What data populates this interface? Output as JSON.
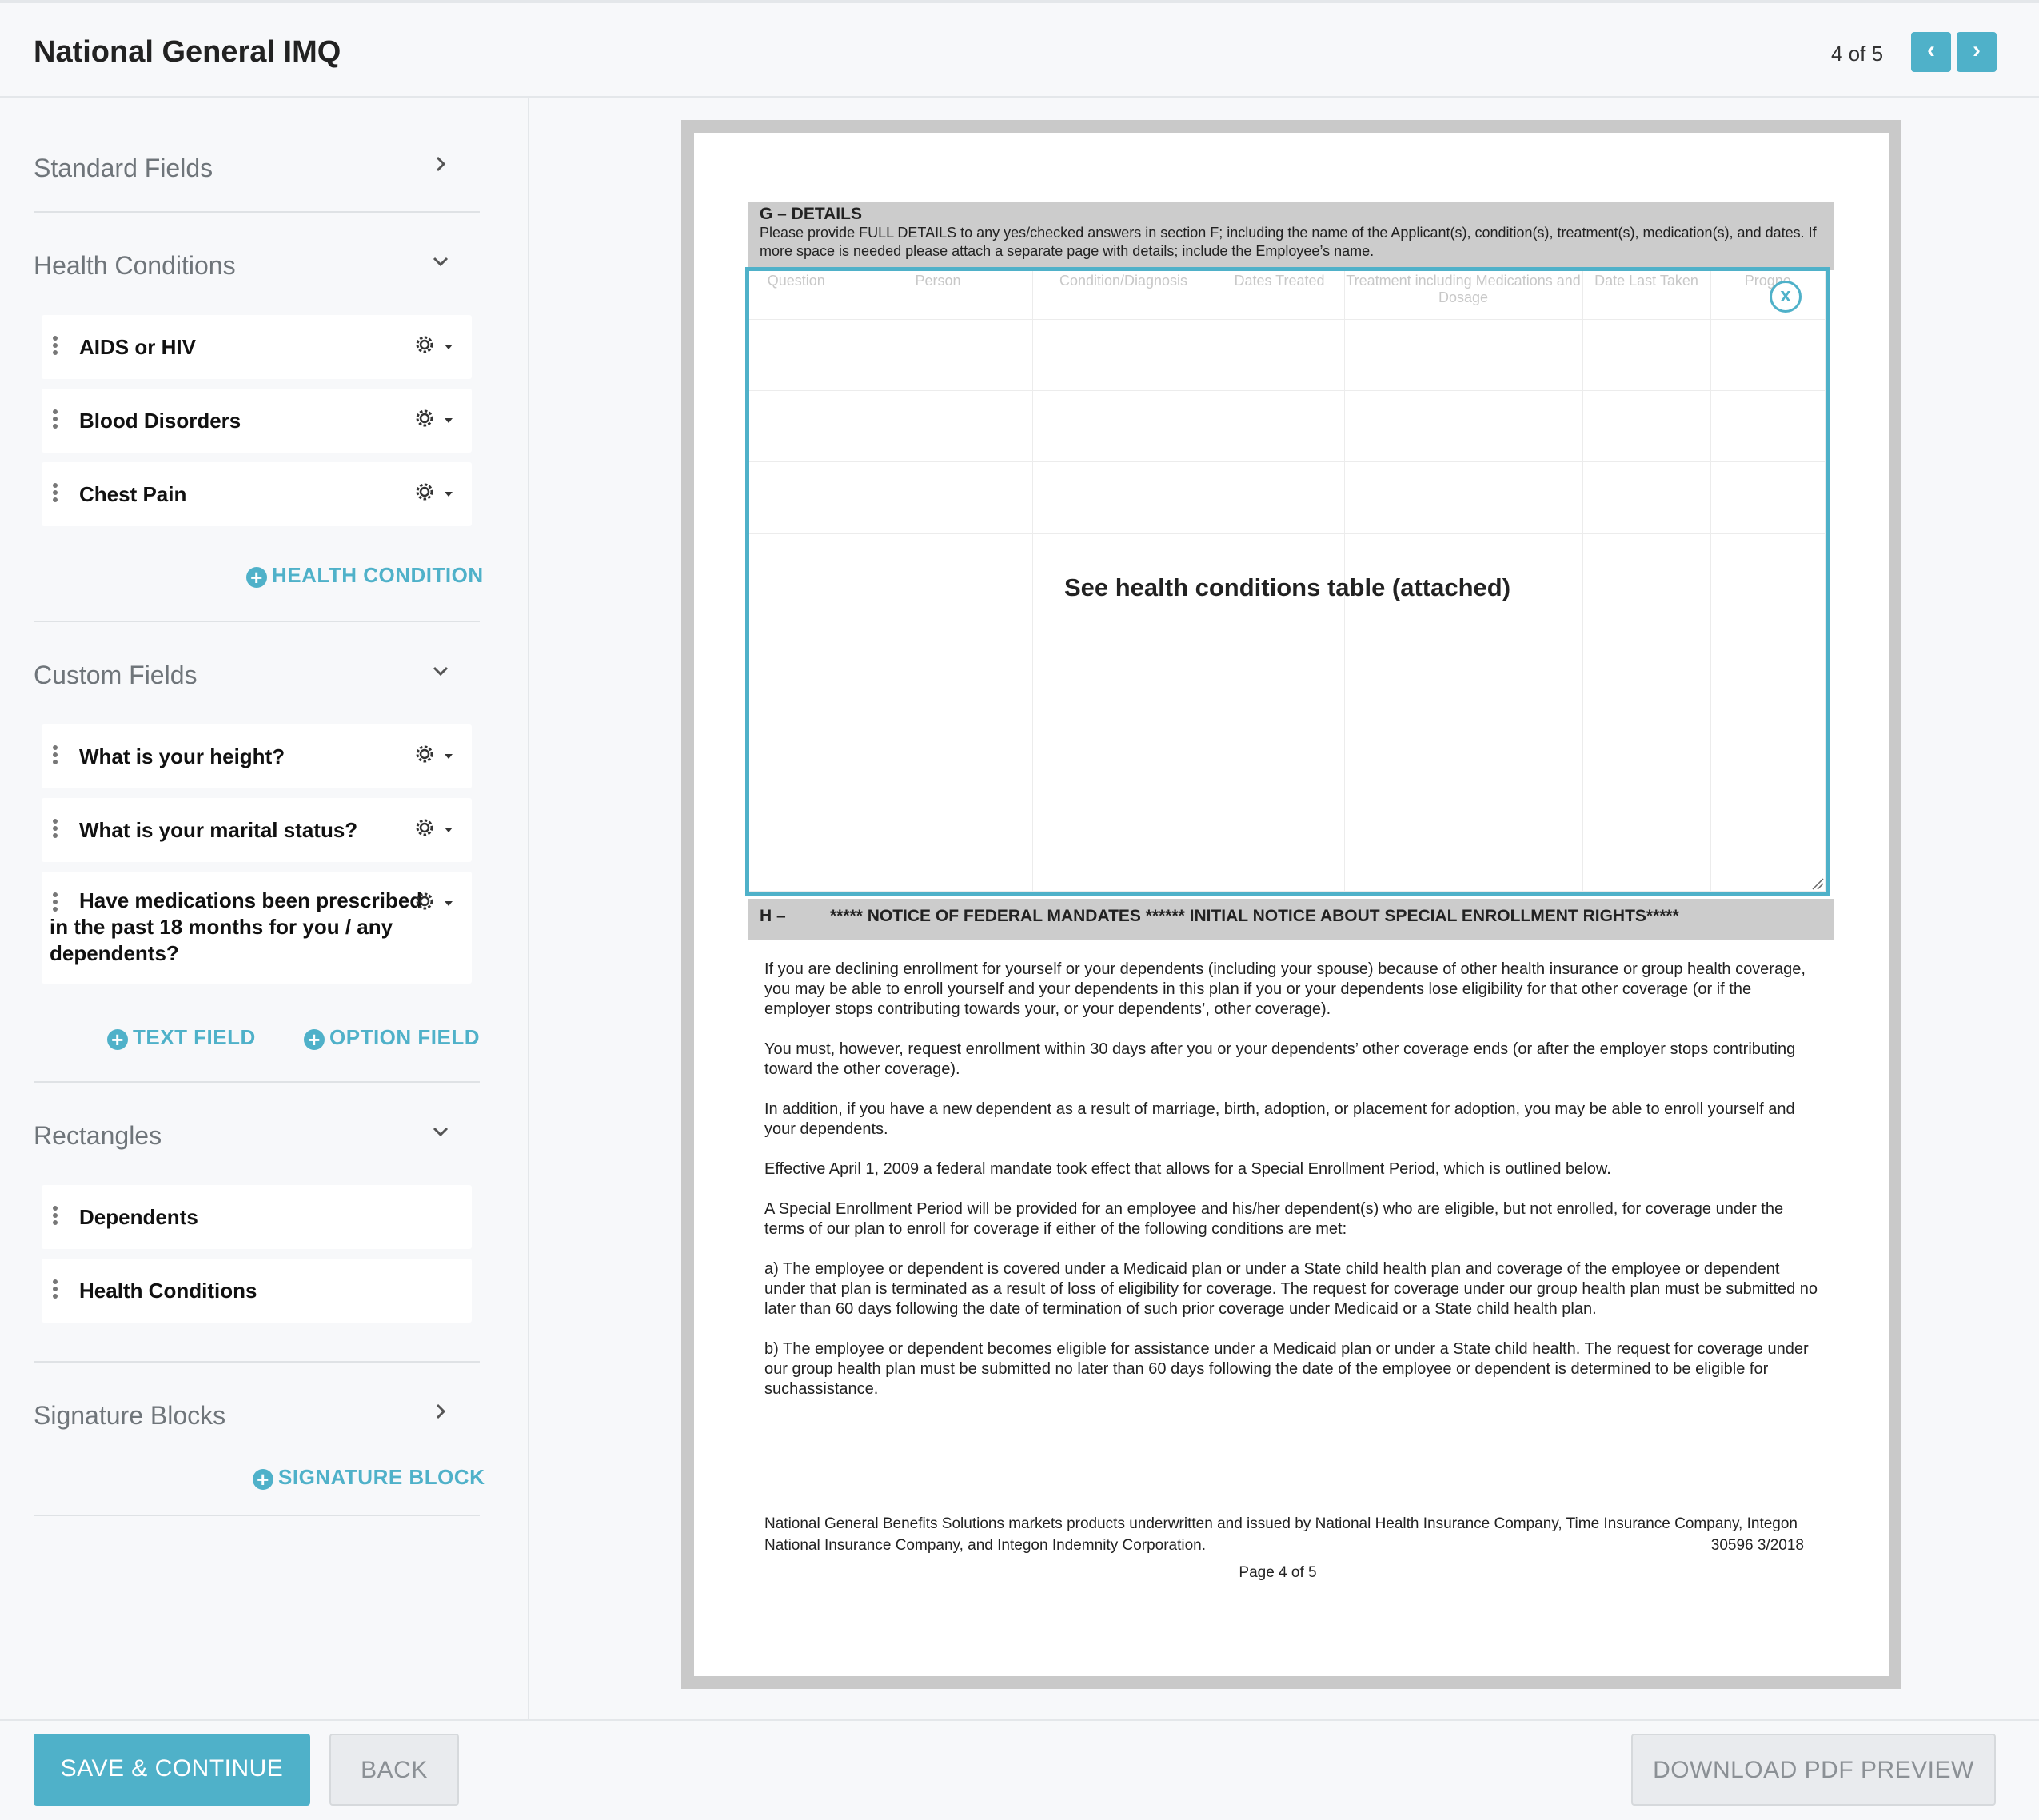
{
  "header": {
    "title": "National General IMQ",
    "pager_text": "4 of 5",
    "prev_symbol": "‹",
    "next_symbol": "›"
  },
  "sidebar": {
    "standard_fields": {
      "title": "Standard Fields"
    },
    "health_conditions": {
      "title": "Health Conditions",
      "items": [
        "AIDS or HIV",
        "Blood Disorders",
        "Chest Pain"
      ],
      "add_label": "HEALTH CONDITION"
    },
    "custom_fields": {
      "title": "Custom Fields",
      "items": [
        "What is your height?",
        "What is your marital status?",
        "Have medications been prescribed in the past 18 months for you / any dependents?"
      ],
      "add_text_label": "TEXT FIELD",
      "add_option_label": "OPTION FIELD"
    },
    "rectangles": {
      "title": "Rectangles",
      "items": [
        "Dependents",
        "Health Conditions"
      ]
    },
    "signature_blocks": {
      "title": "Signature Blocks",
      "add_label": "SIGNATURE BLOCK"
    }
  },
  "document": {
    "g_title": "G – DETAILS",
    "g_desc": "Please provide FULL DETAILS to any yes/checked answers in section F; including the name of the Applicant(s), condition(s), treatment(s), medication(s), and dates. If more space is needed please attach a separate page with details; include the Employee’s name.",
    "table_headers": [
      "Question",
      "Person",
      "Condition/Diagnosis",
      "Dates Treated",
      "Treatment including Medications and Dosage",
      "Date Last Taken",
      "Progno"
    ],
    "overlay_text": "See health conditions table (attached)",
    "close_symbol": "x",
    "h_prefix": "H –",
    "h_title": "***** NOTICE OF FEDERAL MANDATES ****** INITIAL NOTICE ABOUT SPECIAL ENROLLMENT RIGHTS*****",
    "paragraphs": [
      "If you are declining enrollment for yourself or your dependents (including your spouse) because of other health insurance or group health coverage, you may be able to enroll yourself and your dependents in this plan if you or your dependents lose eligibility for that other coverage (or if the employer stops contributing towards your, or your dependents’, other coverage).",
      "You must, however, request enrollment within 30 days after you or your dependents’ other coverage ends (or after the employer stops contributing toward the other coverage).",
      "In addition, if you have a new dependent as a result of marriage, birth, adoption, or placement for adoption, you may be able to enroll yourself and your dependents.",
      "Effective April 1, 2009 a federal mandate took effect that allows for a Special Enrollment Period, which is outlined below.",
      "A Special Enrollment Period will be provided for an employee and his/her dependent(s) who are eligible, but not enrolled, for coverage under the terms of our plan to enroll for coverage if either of the following conditions are met:",
      "a)           The employee or dependent is covered under a Medicaid plan or under a State child health plan and coverage of the employee or dependent under that plan is terminated as a result of loss of eligibility for coverage. The request for coverage under our group health plan must be submitted no later than 60 days following the date of termination of such prior coverage under Medicaid or a State child health plan.",
      "b)           The employee or dependent becomes eligible for assistance under a Medicaid plan or under a State child health. The request for coverage under our group health plan must be submitted no later than 60 days following the date of the employee or dependent is determined to be eligible for suchassistance."
    ],
    "footer_note": "National General Benefits Solutions markets products underwritten and issued by National Health Insurance Company, Time Insurance Company, Integon National Insurance Company, and Integon Indemnity Corporation.",
    "footer_code": "30596 3/2018",
    "page_label": "Page 4 of 5"
  },
  "footer": {
    "save_label": "SAVE & CONTINUE",
    "back_label": "BACK",
    "download_label": "DOWNLOAD PDF PREVIEW"
  },
  "colors": {
    "accent": "#4fb1c9",
    "muted_text": "#6f757a",
    "divider": "#dfe2e5"
  }
}
